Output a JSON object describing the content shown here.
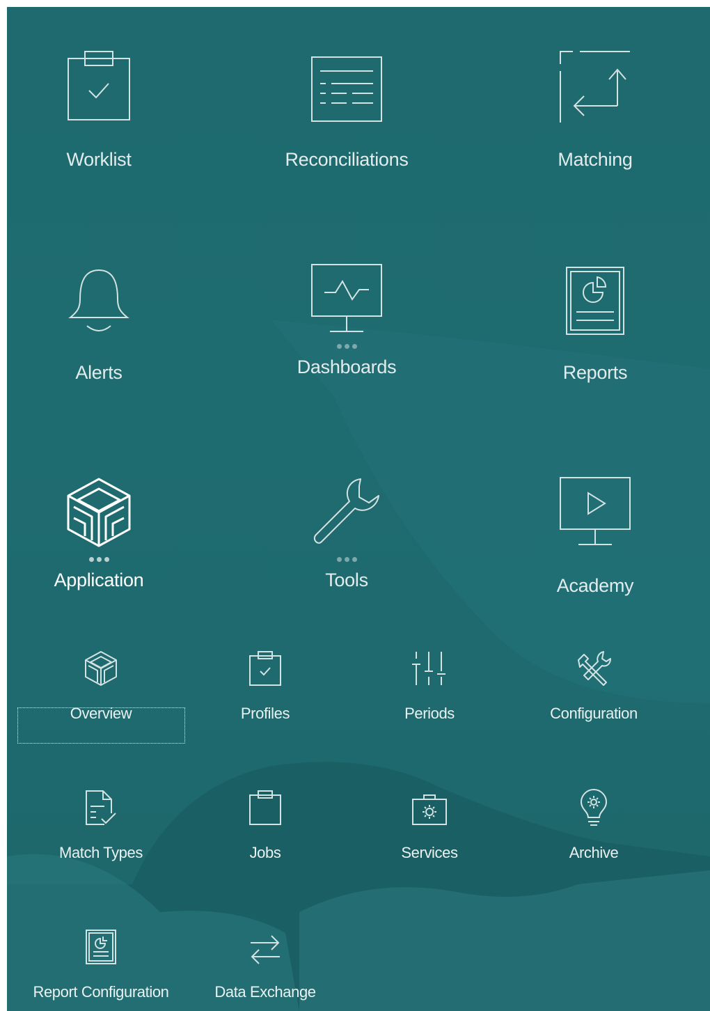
{
  "main_tiles": [
    {
      "label": "Worklist",
      "icon": "clipboard-check-icon",
      "more": false
    },
    {
      "label": "Reconciliations",
      "icon": "document-list-icon",
      "more": false
    },
    {
      "label": "Matching",
      "icon": "matching-arrows-icon",
      "more": false
    },
    {
      "label": "Alerts",
      "icon": "bell-icon",
      "more": false
    },
    {
      "label": "Dashboards",
      "icon": "monitor-pulse-icon",
      "more": true
    },
    {
      "label": "Reports",
      "icon": "report-chart-icon",
      "more": false
    },
    {
      "label": "Application",
      "icon": "cube-icon",
      "more": true
    },
    {
      "label": "Tools",
      "icon": "wrench-icon",
      "more": true
    },
    {
      "label": "Academy",
      "icon": "monitor-play-icon",
      "more": false
    }
  ],
  "sub_tiles": [
    {
      "label": "Overview",
      "icon": "cube-small-icon",
      "focused": true
    },
    {
      "label": "Profiles",
      "icon": "clipboard-small-icon",
      "focused": false
    },
    {
      "label": "Periods",
      "icon": "sliders-icon",
      "focused": false
    },
    {
      "label": "Configuration",
      "icon": "tools-icon",
      "focused": false
    },
    {
      "label": "Match Types",
      "icon": "document-check-icon",
      "focused": false
    },
    {
      "label": "Jobs",
      "icon": "clipboard-empty-icon",
      "focused": false
    },
    {
      "label": "Services",
      "icon": "toolbox-gear-icon",
      "focused": false
    },
    {
      "label": "Archive",
      "icon": "lightbulb-gear-icon",
      "focused": false
    },
    {
      "label": "Report Configuration",
      "icon": "report-settings-icon",
      "focused": false
    },
    {
      "label": "Data Exchange",
      "icon": "exchange-arrows-icon",
      "focused": false
    }
  ],
  "colors": {
    "background": "#1f6c70",
    "icon_stroke": "#d3e2e2",
    "label": "#e6efef"
  }
}
